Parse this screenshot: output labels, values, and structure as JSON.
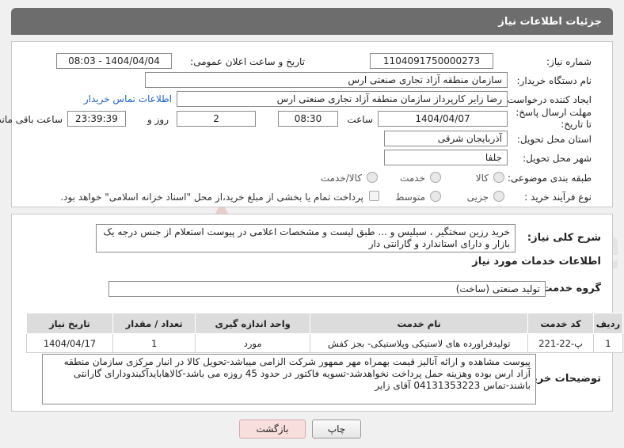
{
  "header": {
    "title": "جزئیات اطلاعات نیاز"
  },
  "fields": {
    "need_number_label": "شماره نیاز:",
    "need_number": "1104091750000273",
    "announce_label": "تاریخ و ساعت اعلان عمومی:",
    "announce_value": "1404/04/04 - 08:03",
    "buyer_org_label": "نام دستگاه خریدار:",
    "buyer_org": "سازمان منطقه آزاد تجاری صنعتی ارس",
    "creator_label": "ایجاد کننده درخواست:",
    "creator": "رضا زایر کارپرداز سازمان منطقه آزاد تجاری صنعتی ارس",
    "contact_link": "اطلاعات تماس خریدار",
    "deadline_label": "مهلت ارسال پاسخ: تا تاریخ:",
    "deadline_date": "1404/04/07",
    "time_label": "ساعت",
    "deadline_time": "08:30",
    "days_value": "2",
    "days_label": "روز و",
    "remaining_time": "23:39:39",
    "remaining_label": "ساعت باقی مانده",
    "province_label": "استان محل تحویل:",
    "province": "آذربایجان شرقی",
    "city_label": "شهر محل تحویل:",
    "city": "جلفا",
    "category_label": "طبقه بندی موضوعی:",
    "category_options": [
      "کالا",
      "خدمت",
      "کالا/خدمت"
    ],
    "purchase_type_label": "نوع فرآیند خرید :",
    "purchase_type_options": [
      "جزیی",
      "متوسط"
    ],
    "payment_note": "پرداخت تمام یا بخشی از مبلغ خرید،از محل \"اسناد خزانه اسلامی\" خواهد بود."
  },
  "summary": {
    "label": "شرح کلی نیاز:",
    "text": "خرید رزین سختگیر ، سیلیس و ... طبق لیست و مشخصات اعلامی در پیوست استعلام از جنس درجه یک بازار و دارای استاندارد و گارانتی دار"
  },
  "services": {
    "section_title": "اطلاعات خدمات مورد نیاز",
    "group_label": "گروه خدمت:",
    "group_value": "تولید صنعتی (ساخت)",
    "columns": [
      "ردیف",
      "کد خدمت",
      "نام خدمت",
      "واحد اندازه گیری",
      "تعداد / مقدار",
      "تاریخ نیاز"
    ],
    "rows": [
      [
        "1",
        "پ-22-221",
        "تولیدفراورده های لاستیکی وپلاستیکی- بجز کفش",
        "مورد",
        "1",
        "1404/04/17"
      ]
    ]
  },
  "buyer_notes": {
    "label": "توضیحات خریدار:",
    "text": "پیوست مشاهده و ارائه آنالیز قیمت بهمراه مهر ممهور شرکت الزامی میباشد-تحویل کالا در انبار مرکزی سازمان منطقه آزاد ارس بوده وهزینه حمل پرداخت نخواهدشد-تسویه فاکتور در حدود 45 روزه می باشد-کالاهابایدآکبندودارای گارانتی باشند-تماس 04131353223 آقای زایر"
  },
  "buttons": {
    "print": "چاپ",
    "back": "بازگشت"
  },
  "watermark": "AriaTender.neT",
  "colors": {
    "header_bg": "#6d6d6d",
    "link": "#1f62c2",
    "back_btn": "#f9dede"
  }
}
